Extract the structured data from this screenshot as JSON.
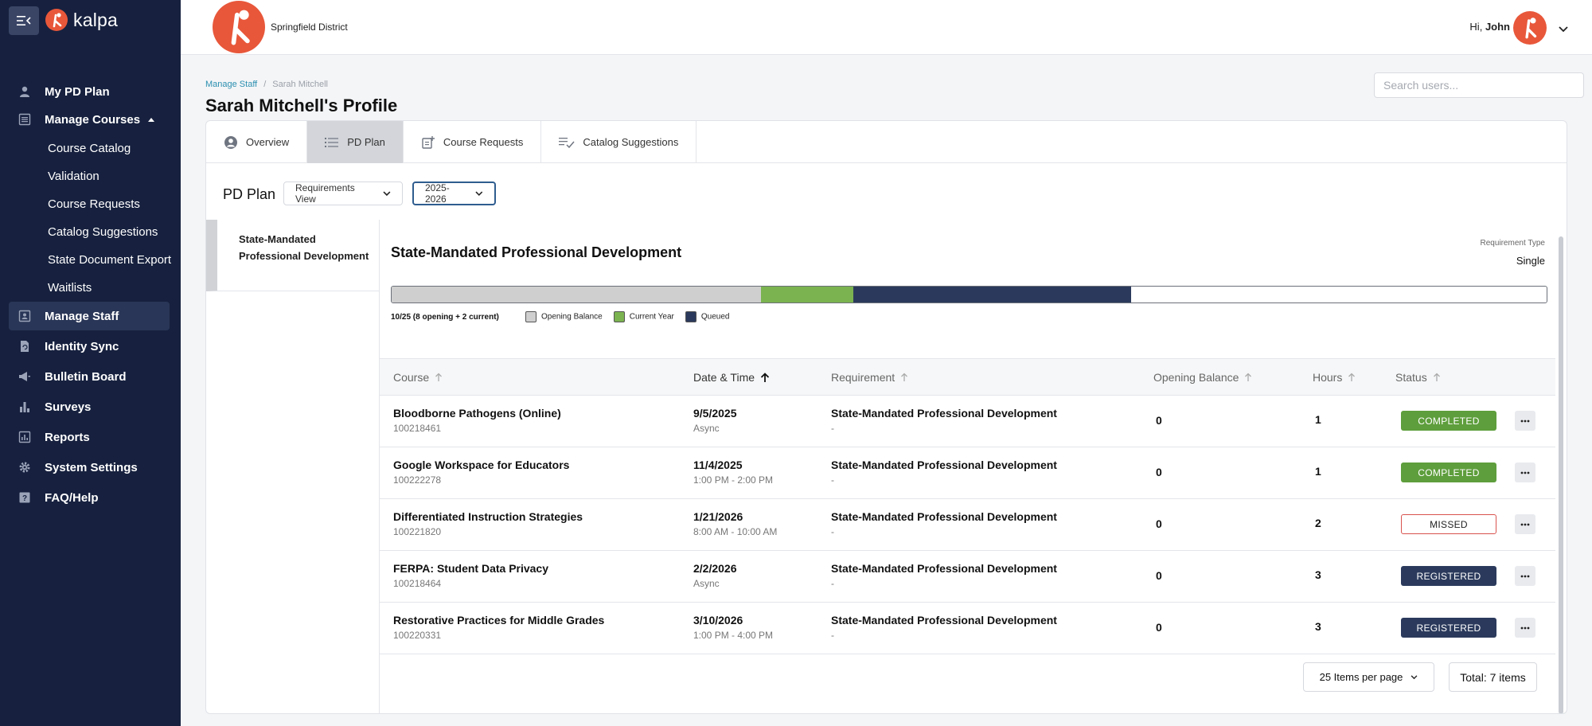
{
  "brand": {
    "name": "kalpa"
  },
  "sidebar": {
    "items": [
      {
        "label": "My PD Plan",
        "icon": "person-icon"
      },
      {
        "label": "Manage Courses",
        "icon": "list-icon"
      },
      {
        "label": "Manage Staff",
        "icon": "staff-icon"
      },
      {
        "label": "Identity Sync",
        "icon": "file-sync-icon"
      },
      {
        "label": "Bulletin Board",
        "icon": "megaphone-icon"
      },
      {
        "label": "Surveys",
        "icon": "bar-chart-icon"
      },
      {
        "label": "Reports",
        "icon": "report-icon"
      },
      {
        "label": "System Settings",
        "icon": "gear-icon"
      },
      {
        "label": "FAQ/Help",
        "icon": "help-icon"
      }
    ],
    "sub_items": [
      "Course Catalog",
      "Validation",
      "Course Requests",
      "Catalog Suggestions",
      "State Document Export",
      "Waitlists"
    ]
  },
  "header": {
    "district": "Springfield District",
    "greeting_prefix": "Hi,",
    "user_name": "John"
  },
  "breadcrumb": {
    "root": "Manage Staff",
    "separator": "/",
    "current": "Sarah Mitchell"
  },
  "page": {
    "title": "Sarah Mitchell's Profile"
  },
  "search": {
    "placeholder": "Search users..."
  },
  "tabs": [
    "Overview",
    "PD Plan",
    "Course Requests",
    "Catalog Suggestions"
  ],
  "pd_plan": {
    "label": "PD Plan",
    "view_dropdown": "Requirements View",
    "year_dropdown": "2025-2026"
  },
  "requirement_nav": {
    "item": "State-Mandated Professional Development"
  },
  "requirement": {
    "title": "State-Mandated Professional Development",
    "type_label": "Requirement Type",
    "type_value": "Single",
    "summary": "10/25 (8 opening + 2 current)",
    "progress": {
      "opening": 8,
      "current": 2,
      "queued": 6,
      "required": 25
    },
    "legend": [
      "Opening Balance",
      "Current Year",
      "Queued"
    ],
    "colors": {
      "opening": "#cfcfcf",
      "current": "#7bb350",
      "queued": "#2b3a5c"
    }
  },
  "table": {
    "headers": [
      "Course",
      "Date & Time",
      "Requirement",
      "Opening Balance",
      "Hours",
      "Status"
    ],
    "rows": [
      {
        "course": "Bloodborne Pathogens (Online)",
        "id": "100218461",
        "date": "9/5/2025",
        "time": "Async",
        "requirement": "State-Mandated Professional Development",
        "req_sub": "-",
        "opening": "0",
        "hours": "1",
        "status": "COMPLETED",
        "status_kind": "completed"
      },
      {
        "course": "Google Workspace for Educators",
        "id": "100222278",
        "date": "11/4/2025",
        "time": "1:00 PM - 2:00 PM",
        "requirement": "State-Mandated Professional Development",
        "req_sub": "-",
        "opening": "0",
        "hours": "1",
        "status": "COMPLETED",
        "status_kind": "completed"
      },
      {
        "course": "Differentiated Instruction Strategies",
        "id": "100221820",
        "date": "1/21/2026",
        "time": "8:00 AM - 10:00 AM",
        "requirement": "State-Mandated Professional Development",
        "req_sub": "-",
        "opening": "0",
        "hours": "2",
        "status": "MISSED",
        "status_kind": "missed"
      },
      {
        "course": "FERPA: Student Data Privacy",
        "id": "100218464",
        "date": "2/2/2026",
        "time": "Async",
        "requirement": "State-Mandated Professional Development",
        "req_sub": "-",
        "opening": "0",
        "hours": "3",
        "status": "REGISTERED",
        "status_kind": "registered"
      },
      {
        "course": "Restorative Practices for Middle Grades",
        "id": "100220331",
        "date": "3/10/2026",
        "time": "1:00 PM - 4:00 PM",
        "requirement": "State-Mandated Professional Development",
        "req_sub": "-",
        "opening": "0",
        "hours": "3",
        "status": "REGISTERED",
        "status_kind": "registered"
      }
    ]
  },
  "pagination": {
    "per_page": "25 Items per page",
    "total": "Total: 7 items"
  }
}
